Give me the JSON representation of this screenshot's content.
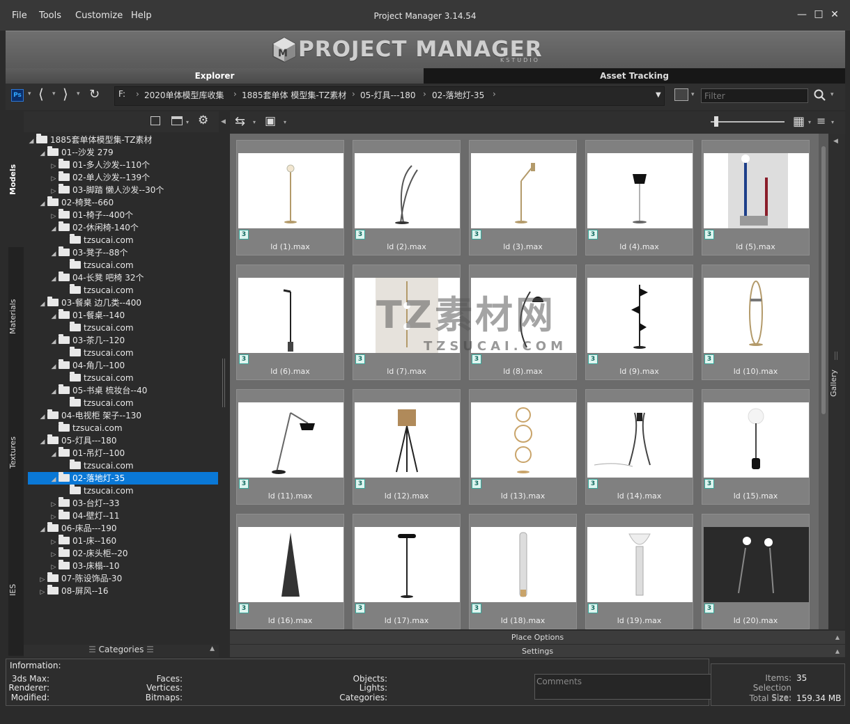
{
  "menu": [
    "File",
    "Tools",
    "Customize",
    "Help"
  ],
  "window": {
    "title": "Project Manager 3.14.54"
  },
  "banner": {
    "logo": "PROJECT MANAGER",
    "logo_sub": "KSTUDIO"
  },
  "tabs": {
    "explorer": "Explorer",
    "asset_tracking": "Asset Tracking"
  },
  "toolbar": {
    "ps_badge": "Ps"
  },
  "breadcrumb": [
    "F:",
    "2020单体模型库收集",
    "1885套单体 模型集-TZ素材",
    "05-灯具---180",
    "02-落地灯-35"
  ],
  "filter": {
    "placeholder": "Filter"
  },
  "side_tabs": [
    "Models",
    "Materials",
    "Textures",
    "IES"
  ],
  "tree": [
    {
      "label": "1885套单体模型集-TZ素材",
      "depth": 0,
      "arrow": "◢",
      "folder": true
    },
    {
      "label": "01--沙发 279",
      "depth": 1,
      "arrow": "◢",
      "folder": true
    },
    {
      "label": "01-多人沙发--110个",
      "depth": 2,
      "arrow": "▷",
      "folder": true
    },
    {
      "label": "02-单人沙发--139个",
      "depth": 2,
      "arrow": "▷",
      "folder": true
    },
    {
      "label": "03-脚踏 懒人沙发--30个",
      "depth": 2,
      "arrow": "▷",
      "folder": true
    },
    {
      "label": "02-椅凳--660",
      "depth": 1,
      "arrow": "◢",
      "folder": true
    },
    {
      "label": "01-椅子--400个",
      "depth": 2,
      "arrow": "▷",
      "folder": true
    },
    {
      "label": "02-休闲椅-140个",
      "depth": 2,
      "arrow": "◢",
      "folder": true
    },
    {
      "label": "tzsucai.com",
      "depth": 3,
      "arrow": "",
      "folder": true
    },
    {
      "label": "03-凳子--88个",
      "depth": 2,
      "arrow": "◢",
      "folder": true
    },
    {
      "label": "tzsucai.com",
      "depth": 3,
      "arrow": "",
      "folder": true
    },
    {
      "label": "04-长凳 吧椅 32个",
      "depth": 2,
      "arrow": "◢",
      "folder": true
    },
    {
      "label": "tzsucai.com",
      "depth": 3,
      "arrow": "",
      "folder": true
    },
    {
      "label": "03-餐桌 边几类--400",
      "depth": 1,
      "arrow": "◢",
      "folder": true
    },
    {
      "label": "01-餐桌--140",
      "depth": 2,
      "arrow": "◢",
      "folder": true
    },
    {
      "label": "tzsucai.com",
      "depth": 3,
      "arrow": "",
      "folder": true
    },
    {
      "label": "03-茶几--120",
      "depth": 2,
      "arrow": "◢",
      "folder": true
    },
    {
      "label": "tzsucai.com",
      "depth": 3,
      "arrow": "",
      "folder": true
    },
    {
      "label": "04-角几--100",
      "depth": 2,
      "arrow": "◢",
      "folder": true
    },
    {
      "label": "tzsucai.com",
      "depth": 3,
      "arrow": "",
      "folder": true
    },
    {
      "label": "05-书桌 梳妆台--40",
      "depth": 2,
      "arrow": "◢",
      "folder": true
    },
    {
      "label": "tzsucai.com",
      "depth": 3,
      "arrow": "",
      "folder": true
    },
    {
      "label": "04-电视柜 架子--130",
      "depth": 1,
      "arrow": "◢",
      "folder": true
    },
    {
      "label": "tzsucai.com",
      "depth": 2,
      "arrow": "",
      "folder": true
    },
    {
      "label": "05-灯具---180",
      "depth": 1,
      "arrow": "◢",
      "folder": true
    },
    {
      "label": "01-吊灯--100",
      "depth": 2,
      "arrow": "◢",
      "folder": true
    },
    {
      "label": "tzsucai.com",
      "depth": 3,
      "arrow": "",
      "folder": true
    },
    {
      "label": "02-落地灯-35",
      "depth": 2,
      "arrow": "◢",
      "folder": true,
      "selected": true
    },
    {
      "label": "tzsucai.com",
      "depth": 3,
      "arrow": "",
      "folder": true
    },
    {
      "label": "03-台灯--33",
      "depth": 2,
      "arrow": "▷",
      "folder": true
    },
    {
      "label": "04-壁灯--11",
      "depth": 2,
      "arrow": "▷",
      "folder": true
    },
    {
      "label": "06-床品---190",
      "depth": 1,
      "arrow": "◢",
      "folder": true
    },
    {
      "label": "01-床--160",
      "depth": 2,
      "arrow": "▷",
      "folder": true
    },
    {
      "label": "02-床头柜--20",
      "depth": 2,
      "arrow": "▷",
      "folder": true
    },
    {
      "label": "03-床榻--10",
      "depth": 2,
      "arrow": "▷",
      "folder": true
    },
    {
      "label": "07-陈设饰品-30",
      "depth": 1,
      "arrow": "▷",
      "folder": true
    },
    {
      "label": "08-屏风--16",
      "depth": 1,
      "arrow": "▷",
      "folder": true
    }
  ],
  "categories_label": "Categories",
  "gallery": {
    "side_label": "Gallery",
    "badge": "3",
    "items": [
      "ld (1).max",
      "ld (2).max",
      "ld (3).max",
      "ld (4).max",
      "ld (5).max",
      "ld (6).max",
      "ld (7).max",
      "ld (8).max",
      "ld (9).max",
      "ld (10).max",
      "ld (11).max",
      "ld (12).max",
      "ld (13).max",
      "ld (14).max",
      "ld (15).max",
      "ld (16).max",
      "ld (17).max",
      "ld (18).max",
      "ld (19).max",
      "ld (20).max"
    ]
  },
  "watermark": {
    "line1": "TZ素材网",
    "line2": "TZSUCAI.COM"
  },
  "place_options": "Place Options",
  "settings": "Settings",
  "info": {
    "title": "Information:",
    "col1": [
      "3ds Max:",
      "Renderer:",
      "Modified:"
    ],
    "col2": [
      "Faces:",
      "Vertices:",
      "Bitmaps:"
    ],
    "col3": [
      "Objects:",
      "Lights:",
      "Categories:"
    ],
    "comments_placeholder": "Comments"
  },
  "stats": {
    "items_label": "Items:",
    "items_value": "35",
    "selection_label": "Selection Size:",
    "selection_value": "",
    "total_label": "Total Size:",
    "total_value": "159.34 MB"
  },
  "colors": {
    "selection": "#0a78d6",
    "badge_border": "#39a89b"
  }
}
